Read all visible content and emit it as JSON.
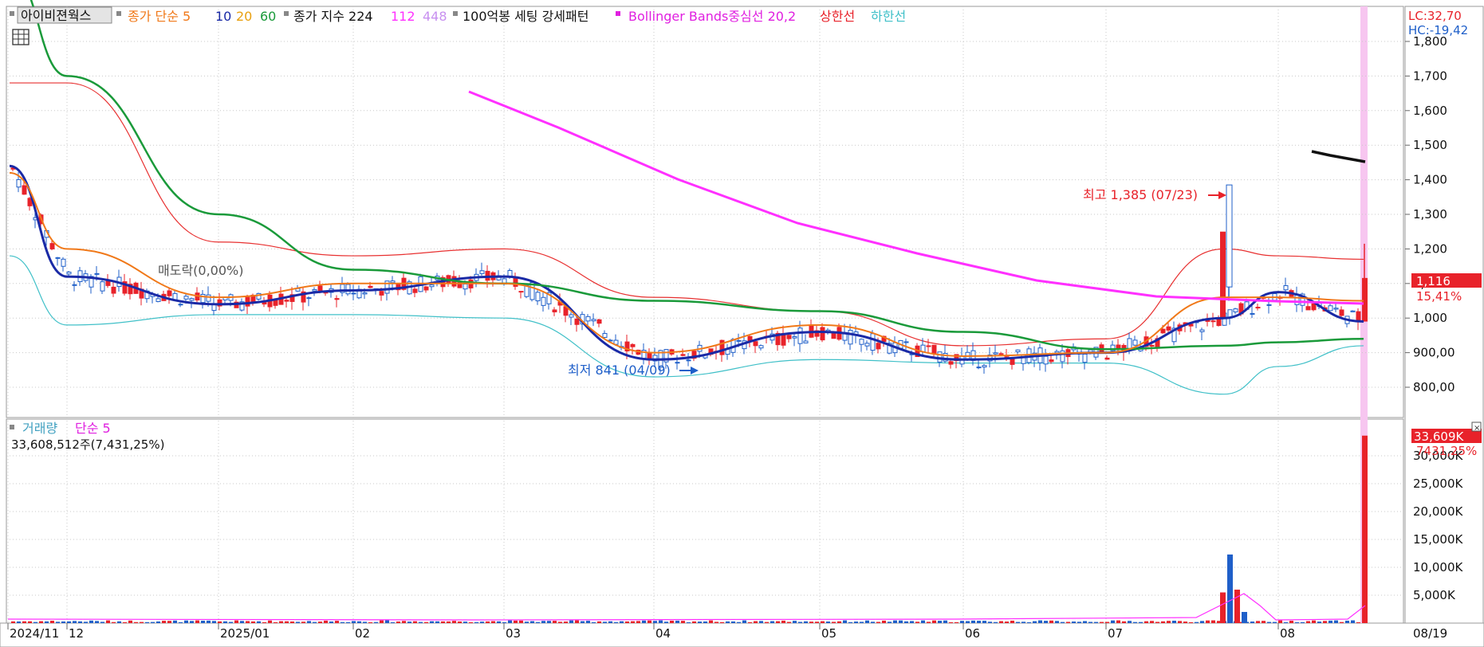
{
  "legend": {
    "stock_name": "아이비젼웍스",
    "ma_label": "종가 단순 5",
    "ma10": "10",
    "ma20": "20",
    "ma60": "60",
    "index_label": "종가 지수 224",
    "idx112": "112",
    "idx448": "448",
    "setting_label": "100억봉 세팅 강세패턴",
    "bb_label": "Bollinger Bands중심선 20,2",
    "bb_upper": "상한선",
    "bb_lower": "하한선"
  },
  "price_panel": {
    "lc": "LC:32,70",
    "hc": "HC:-19,42",
    "current_price": "1,116",
    "current_change": "15,41%",
    "y_ticks": [
      "1,800",
      "1,700",
      "1,600",
      "1,500",
      "1,400",
      "1,300",
      "1,200",
      "1,100",
      "1,000",
      "900,00",
      "800,00"
    ],
    "high_annotation": "최고 1,385 (07/23)",
    "low_annotation": "최저 841 (04/09)",
    "overlay_text": "매도락(0,00%)"
  },
  "volume_panel": {
    "title": "거래량",
    "ma_label": "단순 5",
    "current_volume_text": "33,608,512주(7,431,25%)",
    "current_badge": "33,609K",
    "current_badge_pct": "7431,25%",
    "y_ticks": [
      "30,000K",
      "25,000K",
      "20,000K",
      "15,000K",
      "10,000K",
      "5,000K"
    ]
  },
  "x_axis": {
    "labels": [
      "2024/11",
      "12",
      "2025/01",
      "02",
      "03",
      "04",
      "05",
      "06",
      "07",
      "08"
    ],
    "last_date": "08/19"
  },
  "colors": {
    "up": "#e8222a",
    "down": "#1f5fc9",
    "ma5": "#f07818",
    "ma10": "#1a2aa6",
    "ma20": "#e8a010",
    "ma60": "#1a9a3a",
    "idx224": "#ff30ff",
    "bb_upper": "#e83030",
    "bb_lower": "#40c0c8",
    "highlight": "#f7c6f0"
  },
  "chart_data": {
    "type": "line",
    "title": "",
    "xlabel": "",
    "ylabel": "",
    "ylim": [
      750,
      1900
    ],
    "x": [
      "2024/11",
      "12",
      "2025/01",
      "02",
      "03",
      "04",
      "05",
      "06",
      "07",
      "07/23",
      "08",
      "08/19"
    ],
    "series": [
      {
        "name": "10",
        "values": [
          1440,
          1120,
          1040,
          1080,
          1120,
          880,
          960,
          880,
          900,
          1000,
          1075,
          990
        ]
      },
      {
        "name": "60",
        "values": [
          2000,
          1700,
          1300,
          1140,
          1100,
          1050,
          1020,
          960,
          910,
          920,
          930,
          940
        ]
      },
      {
        "name": "Bollinger Bands중심선 20,2",
        "values": [
          1420,
          1200,
          1060,
          1100,
          1100,
          900,
          980,
          890,
          900,
          1060,
          1060,
          1050
        ]
      },
      {
        "name": "상한선",
        "values": [
          1680,
          1680,
          1220,
          1180,
          1200,
          1060,
          1020,
          920,
          940,
          1200,
          1180,
          1170
        ]
      },
      {
        "name": "하한선",
        "values": [
          1180,
          980,
          1010,
          1010,
          1000,
          830,
          880,
          870,
          870,
          780,
          860,
          920
        ]
      }
    ],
    "annotations": {
      "high": 1385,
      "high_date": "07/23",
      "low": 841,
      "low_date": "04/09",
      "last_close": 1116
    }
  }
}
